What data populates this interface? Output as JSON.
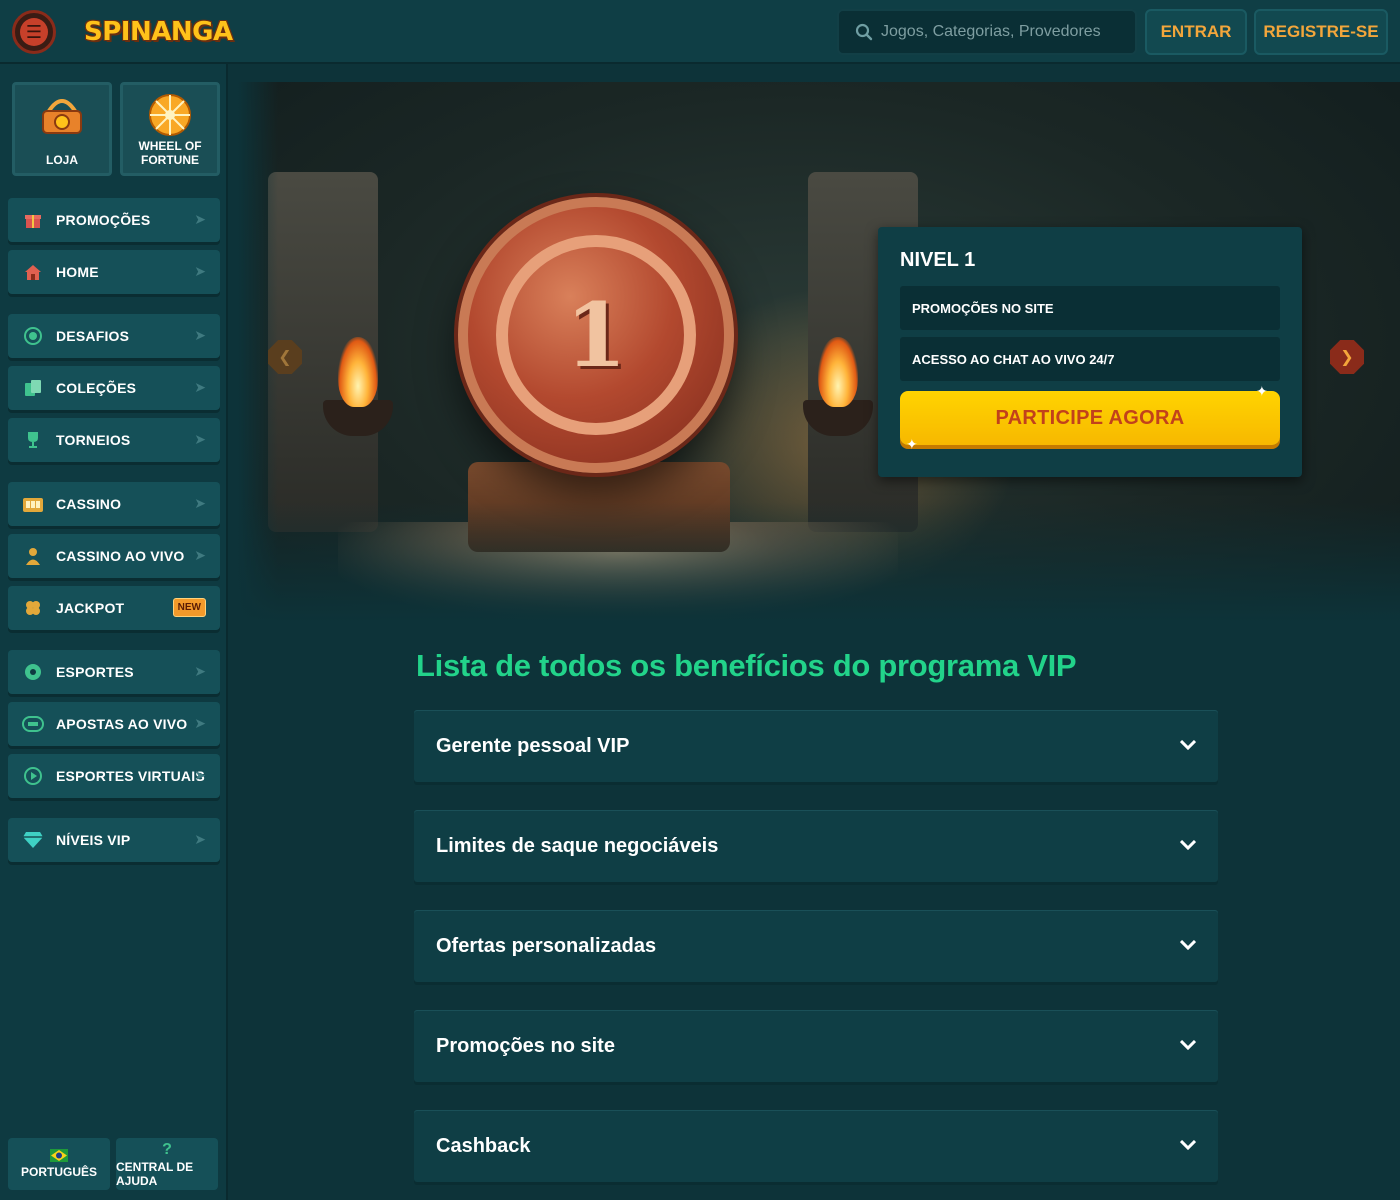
{
  "header": {
    "logo_text": "SPINANGA",
    "search_placeholder": "Jogos, Categorias, Provedores",
    "login_label": "ENTRAR",
    "register_label": "REGISTRE-SE"
  },
  "sidebar": {
    "quick": [
      {
        "label": "LOJA",
        "icon": "basket-icon"
      },
      {
        "label": "WHEEL OF FORTUNE",
        "icon": "wheel-icon"
      }
    ],
    "items": [
      {
        "label": "PROMOÇÕES",
        "icon": "gift-icon"
      },
      {
        "label": "HOME",
        "icon": "home-icon"
      },
      {
        "label": "DESAFIOS",
        "icon": "target-icon"
      },
      {
        "label": "COLEÇÕES",
        "icon": "cards-icon"
      },
      {
        "label": "TORNEIOS",
        "icon": "trophy-icon"
      },
      {
        "label": "CASSINO",
        "icon": "slot-icon"
      },
      {
        "label": "CASSINO AO VIVO",
        "icon": "dealer-icon"
      },
      {
        "label": "JACKPOT",
        "icon": "clover-icon",
        "badge": "NEW"
      },
      {
        "label": "ESPORTES",
        "icon": "soccer-ball-icon"
      },
      {
        "label": "APOSTAS AO VIVO",
        "icon": "live-icon"
      },
      {
        "label": "ESPORTES VIRTUAIS",
        "icon": "play-icon"
      },
      {
        "label": "NÍVEIS VIP",
        "icon": "diamond-icon"
      }
    ],
    "bottom": {
      "language_label": "PORTUGUÊS",
      "help_label": "CENTRAL DE AJUDA",
      "help_glyph": "?"
    }
  },
  "hero": {
    "medallion_number": "1",
    "level_title": "NIVEL 1",
    "perks": [
      "PROMOÇÕES NO SITE",
      "ACESSO AO CHAT AO VIVO 24/7"
    ],
    "cta_label": "PARTICIPE AGORA"
  },
  "benefits": {
    "title": "Lista de todos os benefícios do programa VIP",
    "items": [
      "Gerente pessoal VIP",
      "Limites de saque negociáveis",
      "Ofertas personalizadas",
      "Promoções no site",
      "Cashback"
    ]
  },
  "colors": {
    "background": "#0d3339",
    "panel": "#0f3e45",
    "accent_green": "#22d38a",
    "accent_orange": "#f3a63b",
    "cta_yellow": "#ffd400",
    "cta_text": "#c2411b"
  }
}
